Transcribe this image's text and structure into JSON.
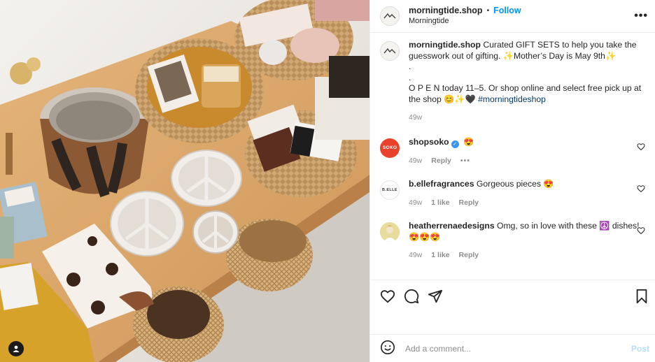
{
  "post": {
    "username": "morningtide.shop",
    "separator": "•",
    "follow_label": "Follow",
    "location": "Morningtide",
    "more_label": "•••"
  },
  "caption": {
    "username": "morningtide.shop",
    "line1": "Curated GIFT SETS to help you take the guesswork out of gifting. ✨Mother’s Day is May 9th✨",
    "dot1": ".",
    "dot2": ".",
    "line2": "O P E N today 11–5. Or shop online and select free pick up at the shop 😊✨🖤",
    "hashtag": "#morningtideshop",
    "time": "49w"
  },
  "comments": [
    {
      "avatar_text": "SOKO",
      "username": "shopsoko",
      "text": "😍",
      "time": "49w",
      "reply_label": "Reply",
      "more": "•••",
      "verified": true
    },
    {
      "avatar_text": "B.ELLE",
      "username": "b.ellefragrances",
      "text": "Gorgeous pieces 😍",
      "time": "49w",
      "likes": "1 like",
      "reply_label": "Reply"
    },
    {
      "avatar_text": "",
      "username": "heatherrenaedesigns",
      "text": "Omg, so in love with these ☮️ dishes! 😍😍😍",
      "time": "49w",
      "likes": "1 like",
      "reply_label": "Reply"
    }
  ],
  "add_comment": {
    "placeholder": "Add a comment...",
    "post_label": "Post"
  },
  "icons": {
    "like": "heart-icon",
    "comment": "comment-icon",
    "share": "share-icon",
    "save": "bookmark-icon",
    "emoji": "emoji-icon",
    "tags": "user-tag-icon"
  },
  "colors": {
    "accent": "#0095f6",
    "post_disabled": "#b2dffc",
    "meta": "#8e8e8e",
    "hashtag": "#00376b"
  }
}
